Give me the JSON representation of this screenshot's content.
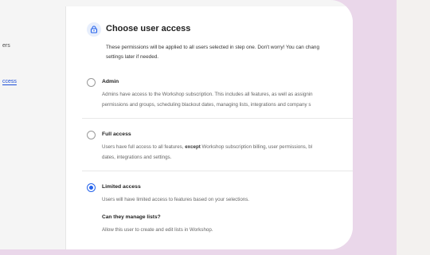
{
  "sidebar": {
    "items": [
      {
        "label": "ers"
      },
      {
        "label": "ccess"
      }
    ]
  },
  "panel": {
    "icon": "lock-icon",
    "title": "Choose user access",
    "intro_line1": "These permissions will be applied to all users selected in step one. Don't worry! You can chang",
    "intro_line2": "settings later if needed."
  },
  "options": [
    {
      "label": "Admin",
      "checked": false,
      "desc_line1": "Admins have access to the Workshop subscription. This includes all features, as well as assignin",
      "desc_line2": "permissions and groups, scheduling blackout dates, managing lists, integrations and company s"
    },
    {
      "label": "Full access",
      "checked": false,
      "desc_pre": "Users have full access to all features, ",
      "desc_bold": "except",
      "desc_post": " Workshop subscription billing, user permissions, bl",
      "desc_line2": "dates, integrations and settings."
    },
    {
      "label": "Limited access",
      "checked": true,
      "desc_line1": "Users will have limited access to features based on your selections.",
      "question": "Can they manage lists?",
      "answer": "Allow this user to create and edit lists in Workshop."
    }
  ],
  "colors": {
    "accent": "#2563eb",
    "background": "#ead7ea"
  }
}
